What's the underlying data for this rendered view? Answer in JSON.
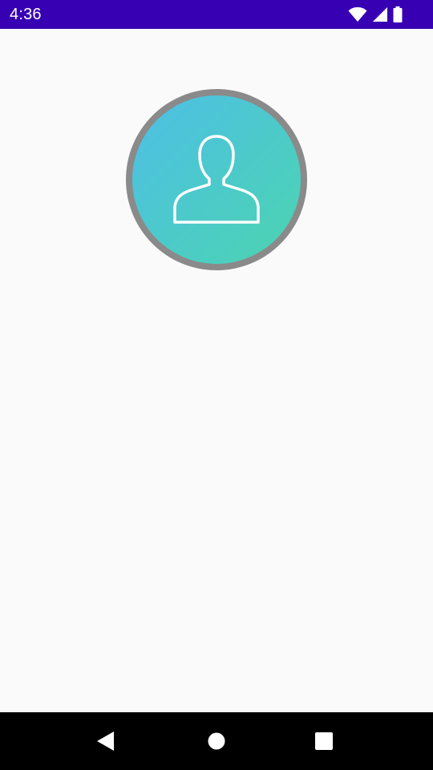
{
  "status_bar": {
    "time": "4:36",
    "icons": [
      "wifi-icon",
      "cell-signal-icon",
      "battery-icon"
    ],
    "background": "#3700b3"
  },
  "profile": {
    "avatar_icon": "person-outline-icon",
    "gradient_start": "#4dbfe6",
    "gradient_end": "#4cd4b0",
    "ring_color": "#8a8a8a"
  },
  "navigation_bar": {
    "buttons": [
      "back-icon",
      "home-icon",
      "recents-icon"
    ]
  }
}
